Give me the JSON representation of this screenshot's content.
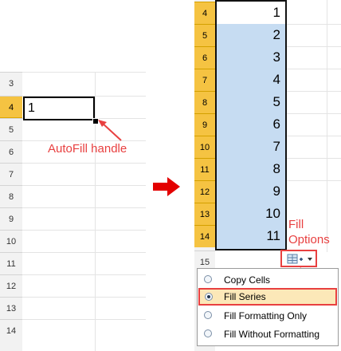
{
  "left_sheet": {
    "row_numbers": [
      "3",
      "4",
      "5",
      "6",
      "7",
      "8",
      "9",
      "10",
      "11",
      "12",
      "13",
      "14"
    ],
    "selected_row": "4",
    "cell_value": "1",
    "autofill_label": "AutoFill handle"
  },
  "right_sheet": {
    "row_numbers": [
      "4",
      "5",
      "6",
      "7",
      "8",
      "9",
      "10",
      "11",
      "12",
      "13",
      "14",
      "15"
    ],
    "values": [
      "1",
      "2",
      "3",
      "4",
      "5",
      "6",
      "7",
      "8",
      "9",
      "10",
      "11"
    ],
    "fill_options_label_line1": "Fill",
    "fill_options_label_line2": "Options"
  },
  "fill_menu": {
    "items": [
      {
        "label": "Copy Cells",
        "selected": false
      },
      {
        "label": "Fill Series",
        "selected": true
      },
      {
        "label": "Fill Formatting Only",
        "selected": false
      },
      {
        "label": "Fill Without Formatting",
        "selected": false
      }
    ]
  },
  "colors": {
    "selected_row_header": "#f5c342",
    "fill_highlight": "#c6dcf2",
    "annotation_red": "#e84040"
  }
}
